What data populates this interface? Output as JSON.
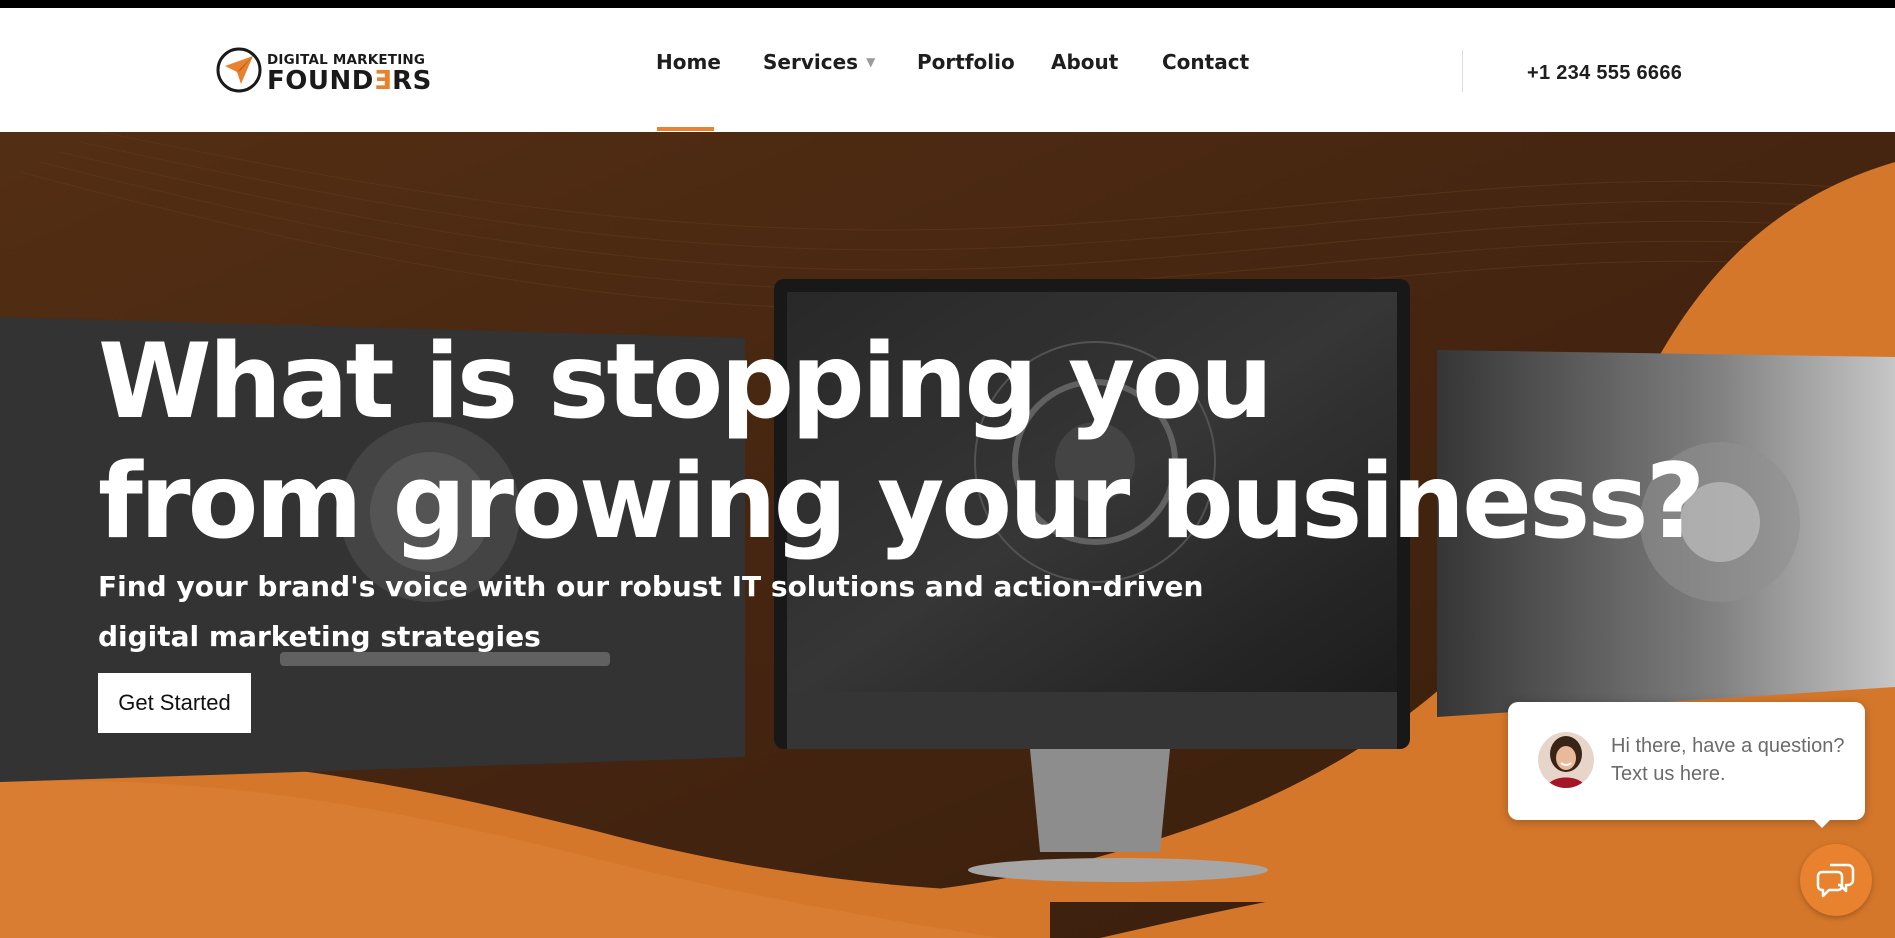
{
  "header": {
    "logo": {
      "line1": "DIGITAL MARKETING",
      "line2_a": "FOUND",
      "line2_accent": "Ǝ",
      "line2_b": "RS"
    },
    "nav": [
      {
        "label": "Home",
        "active": true
      },
      {
        "label": "Services",
        "has_dropdown": true
      },
      {
        "label": "Portfolio"
      },
      {
        "label": "About"
      },
      {
        "label": "Contact"
      }
    ],
    "phone": "+1 234 555 6666"
  },
  "hero": {
    "headline_line1": "What is stopping you",
    "headline_line2": "from growing your business?",
    "subheading": "Find your brand's voice with our robust IT solutions and action-driven digital marketing strategies",
    "cta_label": "Get Started"
  },
  "chat": {
    "message": "Hi there, have a question? Text us here.",
    "icon": "chat-bubbles-icon"
  },
  "colors": {
    "accent": "#e8822f",
    "hero_brown": "#4a2812",
    "text_dark": "#1e1e1e"
  }
}
